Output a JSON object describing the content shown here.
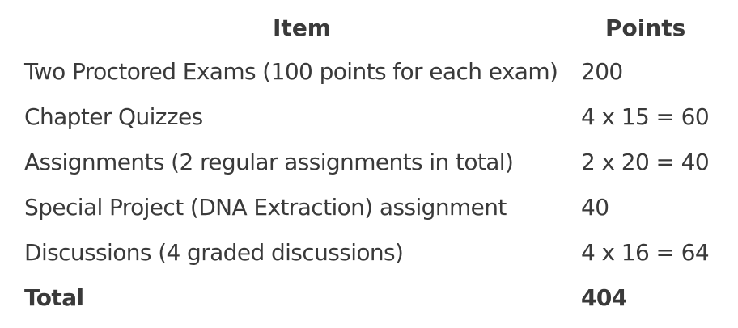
{
  "table": {
    "headers": {
      "item": "Item",
      "points": "Points"
    },
    "rows": [
      {
        "item": "Two Proctored Exams (100 points for each exam)",
        "points": "200"
      },
      {
        "item": "Chapter Quizzes",
        "points": "4 x 15 = 60"
      },
      {
        "item": "Assignments (2 regular assignments in total)",
        "points": "2 x 20 = 40"
      },
      {
        "item": "Special Project (DNA Extraction) assignment",
        "points": "40"
      },
      {
        "item": "Discussions (4 graded discussions)",
        "points": "4 x 16 = 64"
      }
    ],
    "total": {
      "item": "Total",
      "points": "404"
    }
  }
}
